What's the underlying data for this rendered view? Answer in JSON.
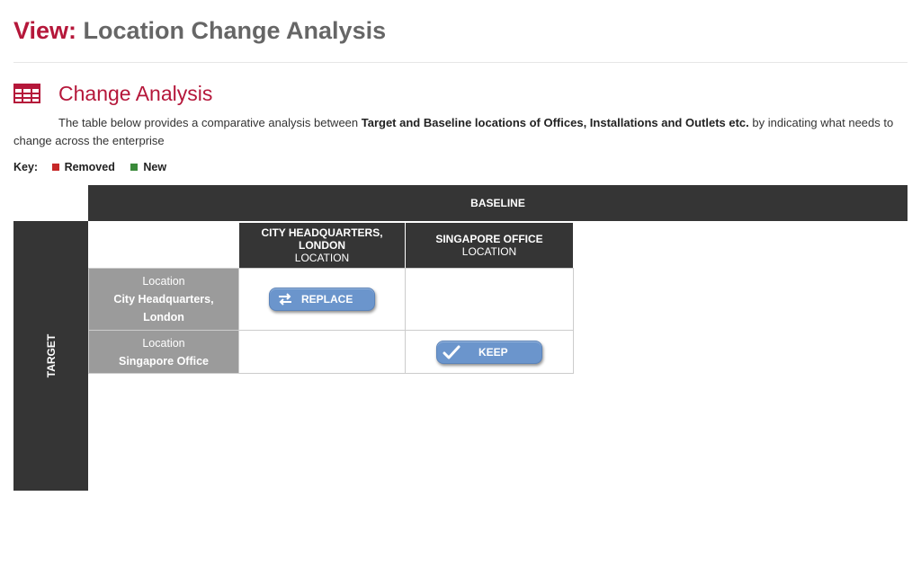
{
  "header": {
    "prefix": "View:",
    "title": "Location Change Analysis"
  },
  "section": {
    "icon": "table-icon",
    "title": "Change Analysis",
    "description": {
      "part1": "The table below provides a comparative analysis between ",
      "bold1": "Target and Baseline  locations of Offices, Installations and Outlets etc.",
      "part2": "  by indicating what needs to change across  the enterprise"
    }
  },
  "key": {
    "title": "Key:",
    "items": [
      {
        "label": "Removed",
        "color": "#c62828"
      },
      {
        "label": "New",
        "color": "#3a8a3a"
      }
    ]
  },
  "matrix": {
    "baseline_label": "BASELINE",
    "target_label": "TARGET",
    "columns": [
      {
        "name": "CITY HEADQUARTERS, LONDON",
        "type": "LOCATION"
      },
      {
        "name": "SINGAPORE OFFICE",
        "type": "LOCATION"
      }
    ],
    "rows": [
      {
        "type": "Location",
        "name": "City Headquarters, London"
      },
      {
        "type": "Location",
        "name": "Singapore Office"
      }
    ],
    "actions": [
      {
        "label": "REPLACE",
        "icon": "swap-arrows-icon",
        "row": 1,
        "column": 1
      },
      {
        "label": "KEEP",
        "icon": "checkmark-icon",
        "row": 2,
        "column": 2
      }
    ]
  },
  "colors": {
    "accent": "#b5173a",
    "header_dark": "#353535",
    "row_header": "#9b9b9b",
    "action_button": "#6b95cc"
  }
}
